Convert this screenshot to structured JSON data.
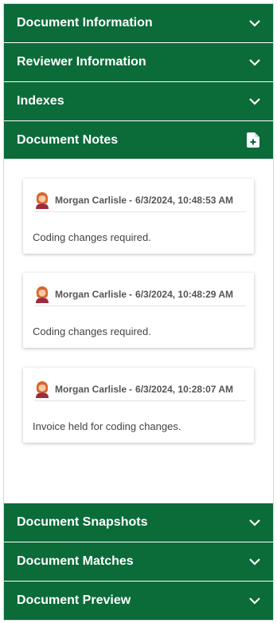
{
  "sections": {
    "document_information": "Document Information",
    "reviewer_information": "Reviewer Information",
    "indexes": "Indexes",
    "document_notes": "Document Notes",
    "document_snapshots": "Document Snapshots",
    "document_matches": "Document Matches",
    "document_preview": "Document Preview"
  },
  "notes": [
    {
      "author": "Morgan Carlisle",
      "separator": "-",
      "timestamp": "6/3/2024, 10:48:53 AM",
      "text": "Coding changes required."
    },
    {
      "author": "Morgan Carlisle",
      "separator": "-",
      "timestamp": "6/3/2024, 10:48:29 AM",
      "text": "Coding changes required."
    },
    {
      "author": "Morgan Carlisle",
      "separator": "-",
      "timestamp": "6/3/2024, 10:28:07 AM",
      "text": "Invoice held for coding changes."
    }
  ],
  "colors": {
    "header_bg": "#0b6b39",
    "header_text": "#ffffff"
  },
  "icons": {
    "expand": "chevron-down-icon",
    "add_note": "add-document-icon",
    "avatar": "user-avatar-icon"
  }
}
